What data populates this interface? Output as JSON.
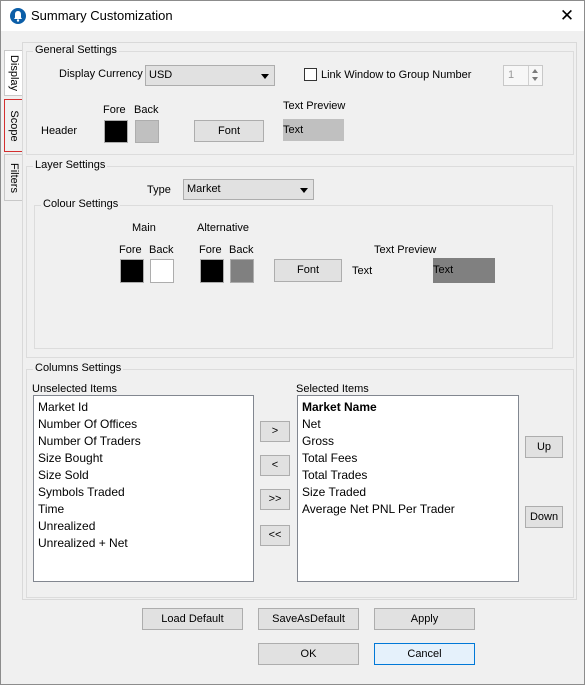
{
  "window": {
    "title": "Summary Customization",
    "app_icon": "app-circle-icon",
    "close_glyph": "✕"
  },
  "tabs": [
    {
      "label": "Display",
      "selected": true
    },
    {
      "label": "Scope",
      "selected": false,
      "highlighted": true
    },
    {
      "label": "Filters",
      "selected": false
    }
  ],
  "general": {
    "title": "General Settings",
    "display_currency_label": "Display Currency",
    "currency_value": "USD",
    "link_window_label": "Link Window to Group Number",
    "link_window_checked": false,
    "group_number": "1",
    "fore_label": "Fore",
    "back_label": "Back",
    "header_label": "Header",
    "font_button": "Font",
    "text_preview_label": "Text Preview",
    "text_preview_sample": "Text",
    "colors": {
      "header_fore": "#000000",
      "header_back": "#c0c0c0",
      "preview_back": "#c0c0c0"
    }
  },
  "layer": {
    "title": "Layer Settings",
    "type_label": "Type",
    "type_value": "Market",
    "colour_settings_title": "Colour Settings",
    "main_label": "Main",
    "alternative_label": "Alternative",
    "fore_label": "Fore",
    "back_label": "Back",
    "font_button": "Font",
    "text_label": "Text",
    "text_preview_label": "Text Preview",
    "text_preview_sample": "Text",
    "colors": {
      "main_fore": "#000000",
      "main_back": "#ffffff",
      "alt_fore": "#000000",
      "alt_back": "#808080",
      "preview_back": "#808080"
    }
  },
  "columns": {
    "title": "Columns Settings",
    "unselected_label": "Unselected Items",
    "selected_label": "Selected Items",
    "unselected": [
      "Market Id",
      "Number Of Offices",
      "Number Of Traders",
      "Size Bought",
      "Size Sold",
      "Symbols Traded",
      "Time",
      "Unrealized",
      "Unrealized + Net"
    ],
    "selected": [
      "Market Name",
      "Net",
      "Gross",
      "Total Fees",
      "Total Trades",
      "Size Traded",
      "Average Net PNL Per Trader"
    ],
    "move_right": ">",
    "move_left": "<",
    "move_all_right": ">>",
    "move_all_left": "<<",
    "up": "Up",
    "down": "Down"
  },
  "footer": {
    "load_default": "Load Default",
    "save_as_default": "SaveAsDefault",
    "apply": "Apply",
    "ok": "OK",
    "cancel": "Cancel"
  }
}
